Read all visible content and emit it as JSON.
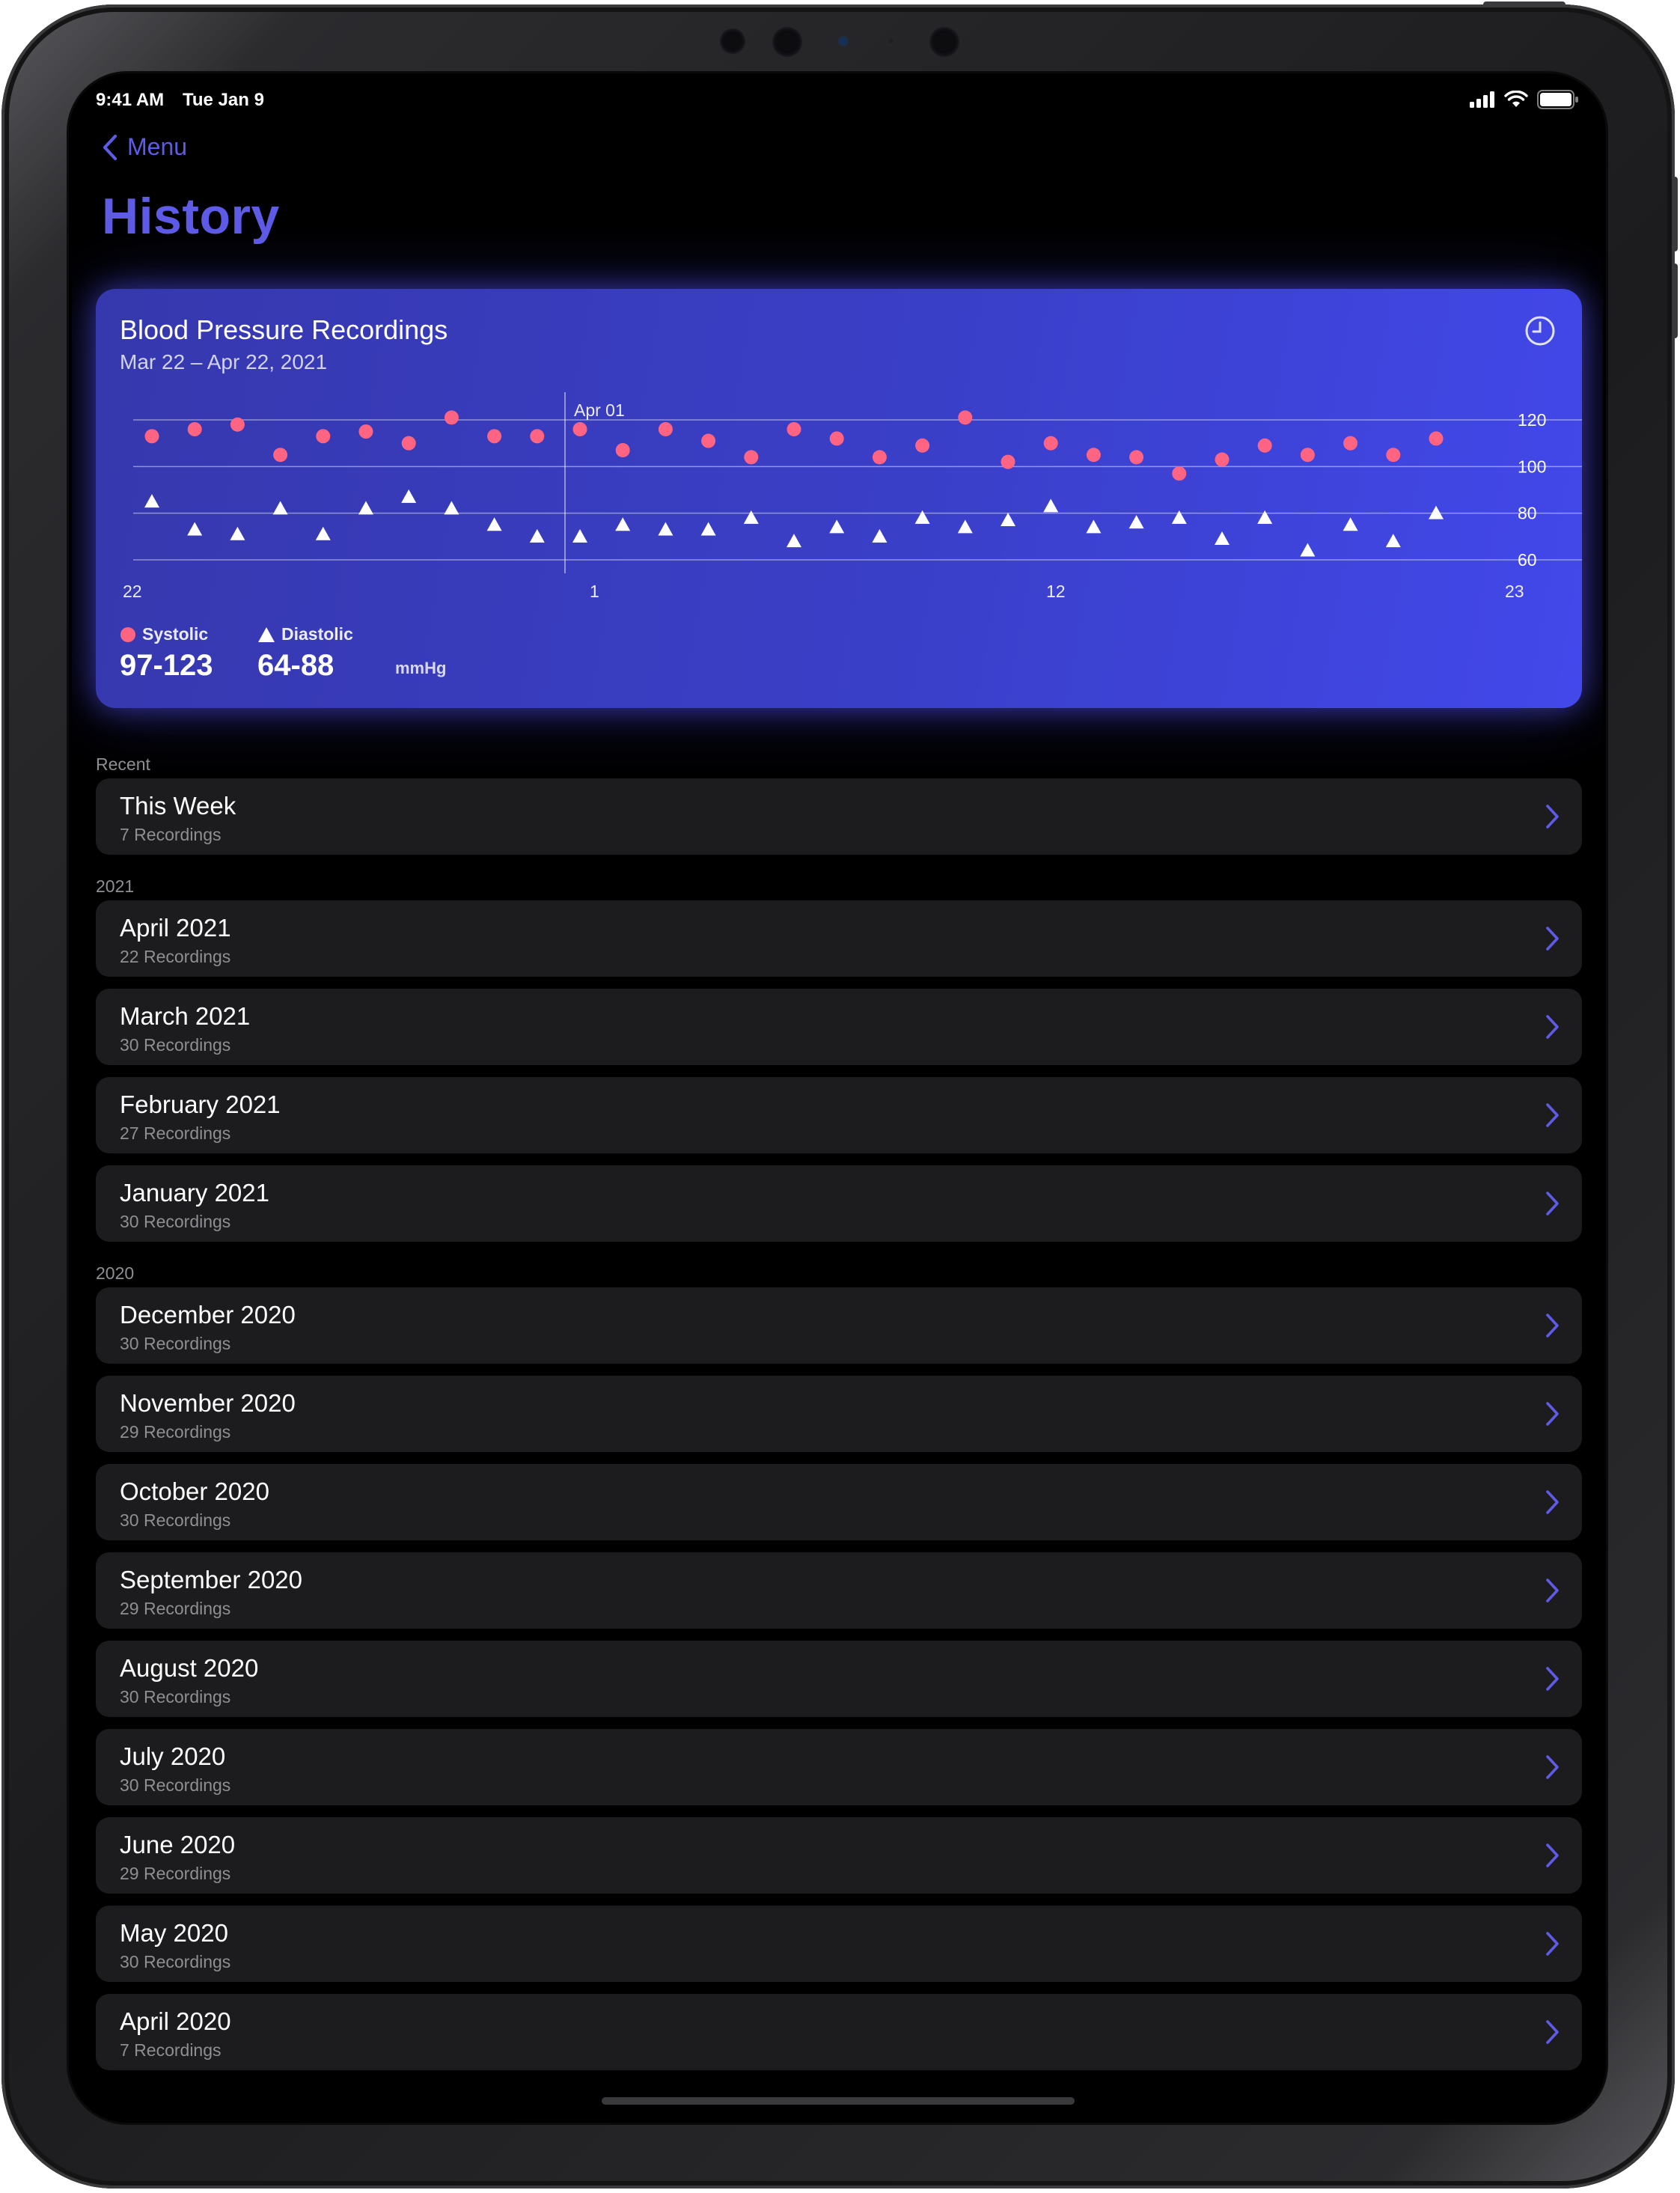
{
  "status_bar": {
    "time": "9:41 AM",
    "date": "Tue Jan 9"
  },
  "nav": {
    "back_label": "Menu",
    "title": "History"
  },
  "colors": {
    "accent": "#5e5ce6",
    "systolic": "#ff6482",
    "diastolic": "#ffffff",
    "card_from": "#3638ad",
    "card_to": "#4248ea"
  },
  "summary_card": {
    "title": "Blood Pressure Recordings",
    "subtitle": "Mar 22 – Apr 22, 2021",
    "icon": "clock-icon",
    "systolic_label": "Systolic",
    "systolic_range": "97-123",
    "diastolic_label": "Diastolic",
    "diastolic_range": "64-88",
    "unit": "mmHg"
  },
  "chart_data": {
    "type": "scatter",
    "x_tick_labels": [
      "22",
      "1",
      "12",
      "23"
    ],
    "y_tick_labels": [
      "120",
      "100",
      "80",
      "60"
    ],
    "ylim": [
      60,
      120
    ],
    "annotation": "Apr 01",
    "grid": true,
    "series": [
      {
        "name": "Systolic",
        "marker": "circle",
        "values": [
          113,
          116,
          118,
          105,
          113,
          115,
          110,
          121,
          113,
          113,
          116,
          107,
          116,
          111,
          104,
          116,
          112,
          104,
          109,
          121,
          102,
          110,
          105,
          104,
          97,
          103,
          109,
          105,
          110,
          105,
          112
        ]
      },
      {
        "name": "Diastolic",
        "marker": "triangle",
        "values": [
          85,
          73,
          71,
          82,
          71,
          82,
          87,
          82,
          75,
          70,
          70,
          75,
          73,
          73,
          78,
          68,
          74,
          70,
          78,
          74,
          77,
          83,
          74,
          76,
          78,
          69,
          78,
          64,
          75,
          68,
          80
        ]
      }
    ]
  },
  "sections": [
    {
      "label": "Recent",
      "rows": [
        {
          "title": "This Week",
          "count": "7 Recordings"
        }
      ]
    },
    {
      "label": "2021",
      "rows": [
        {
          "title": "April 2021",
          "count": "22 Recordings"
        },
        {
          "title": "March 2021",
          "count": "30 Recordings"
        },
        {
          "title": "February 2021",
          "count": "27 Recordings"
        },
        {
          "title": "January 2021",
          "count": "30 Recordings"
        }
      ]
    },
    {
      "label": "2020",
      "rows": [
        {
          "title": "December 2020",
          "count": "30 Recordings"
        },
        {
          "title": "November 2020",
          "count": "29 Recordings"
        },
        {
          "title": "October 2020",
          "count": "30 Recordings"
        },
        {
          "title": "September 2020",
          "count": "29 Recordings"
        },
        {
          "title": "August 2020",
          "count": "30 Recordings"
        },
        {
          "title": "July 2020",
          "count": "30 Recordings"
        },
        {
          "title": "June 2020",
          "count": "29 Recordings"
        },
        {
          "title": "May 2020",
          "count": "30 Recordings"
        },
        {
          "title": "April 2020",
          "count": "7 Recordings"
        }
      ]
    }
  ]
}
